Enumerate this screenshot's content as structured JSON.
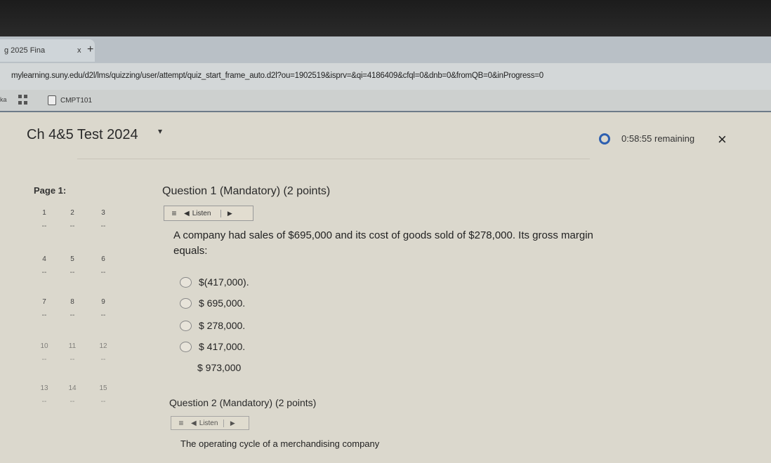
{
  "browser": {
    "tab_title": "g 2025 Fina",
    "tab_close": "x",
    "new_tab": "+",
    "url": "mylearning.suny.edu/d2l/lms/quizzing/user/attempt/quiz_start_frame_auto.d2l?ou=1902519&isprv=&qi=4186409&cfql=0&dnb=0&fromQB=0&inProgress=0",
    "bookmark_left": "ka",
    "bookmark_course": "CMPT101"
  },
  "quiz": {
    "title": "Ch 4&5 Test 2024",
    "timer": "0:58:55 remaining",
    "close": "×",
    "page_label": "Page 1:",
    "question_grid": [
      {
        "n": "1"
      },
      {
        "n": "2"
      },
      {
        "n": "3"
      },
      {
        "n": "4"
      },
      {
        "n": "5"
      },
      {
        "n": "6"
      },
      {
        "n": "7"
      },
      {
        "n": "8"
      },
      {
        "n": "9"
      },
      {
        "n": "10"
      },
      {
        "n": "11"
      },
      {
        "n": "12"
      },
      {
        "n": "13"
      },
      {
        "n": "14"
      },
      {
        "n": "15"
      }
    ],
    "q1": {
      "title": "Question 1 (Mandatory) (2 points)",
      "listen": "Listen",
      "text": "A company had sales of $695,000 and its cost of goods sold of $278,000. Its gross margin equals:",
      "options": [
        "$(417,000).",
        "$ 695,000.",
        "$ 278,000.",
        "$ 417,000.",
        "$ 973,000"
      ]
    },
    "q2": {
      "title": "Question 2 (Mandatory) (2 points)",
      "listen": "Listen",
      "text": "The operating cycle of a merchandising company"
    }
  }
}
